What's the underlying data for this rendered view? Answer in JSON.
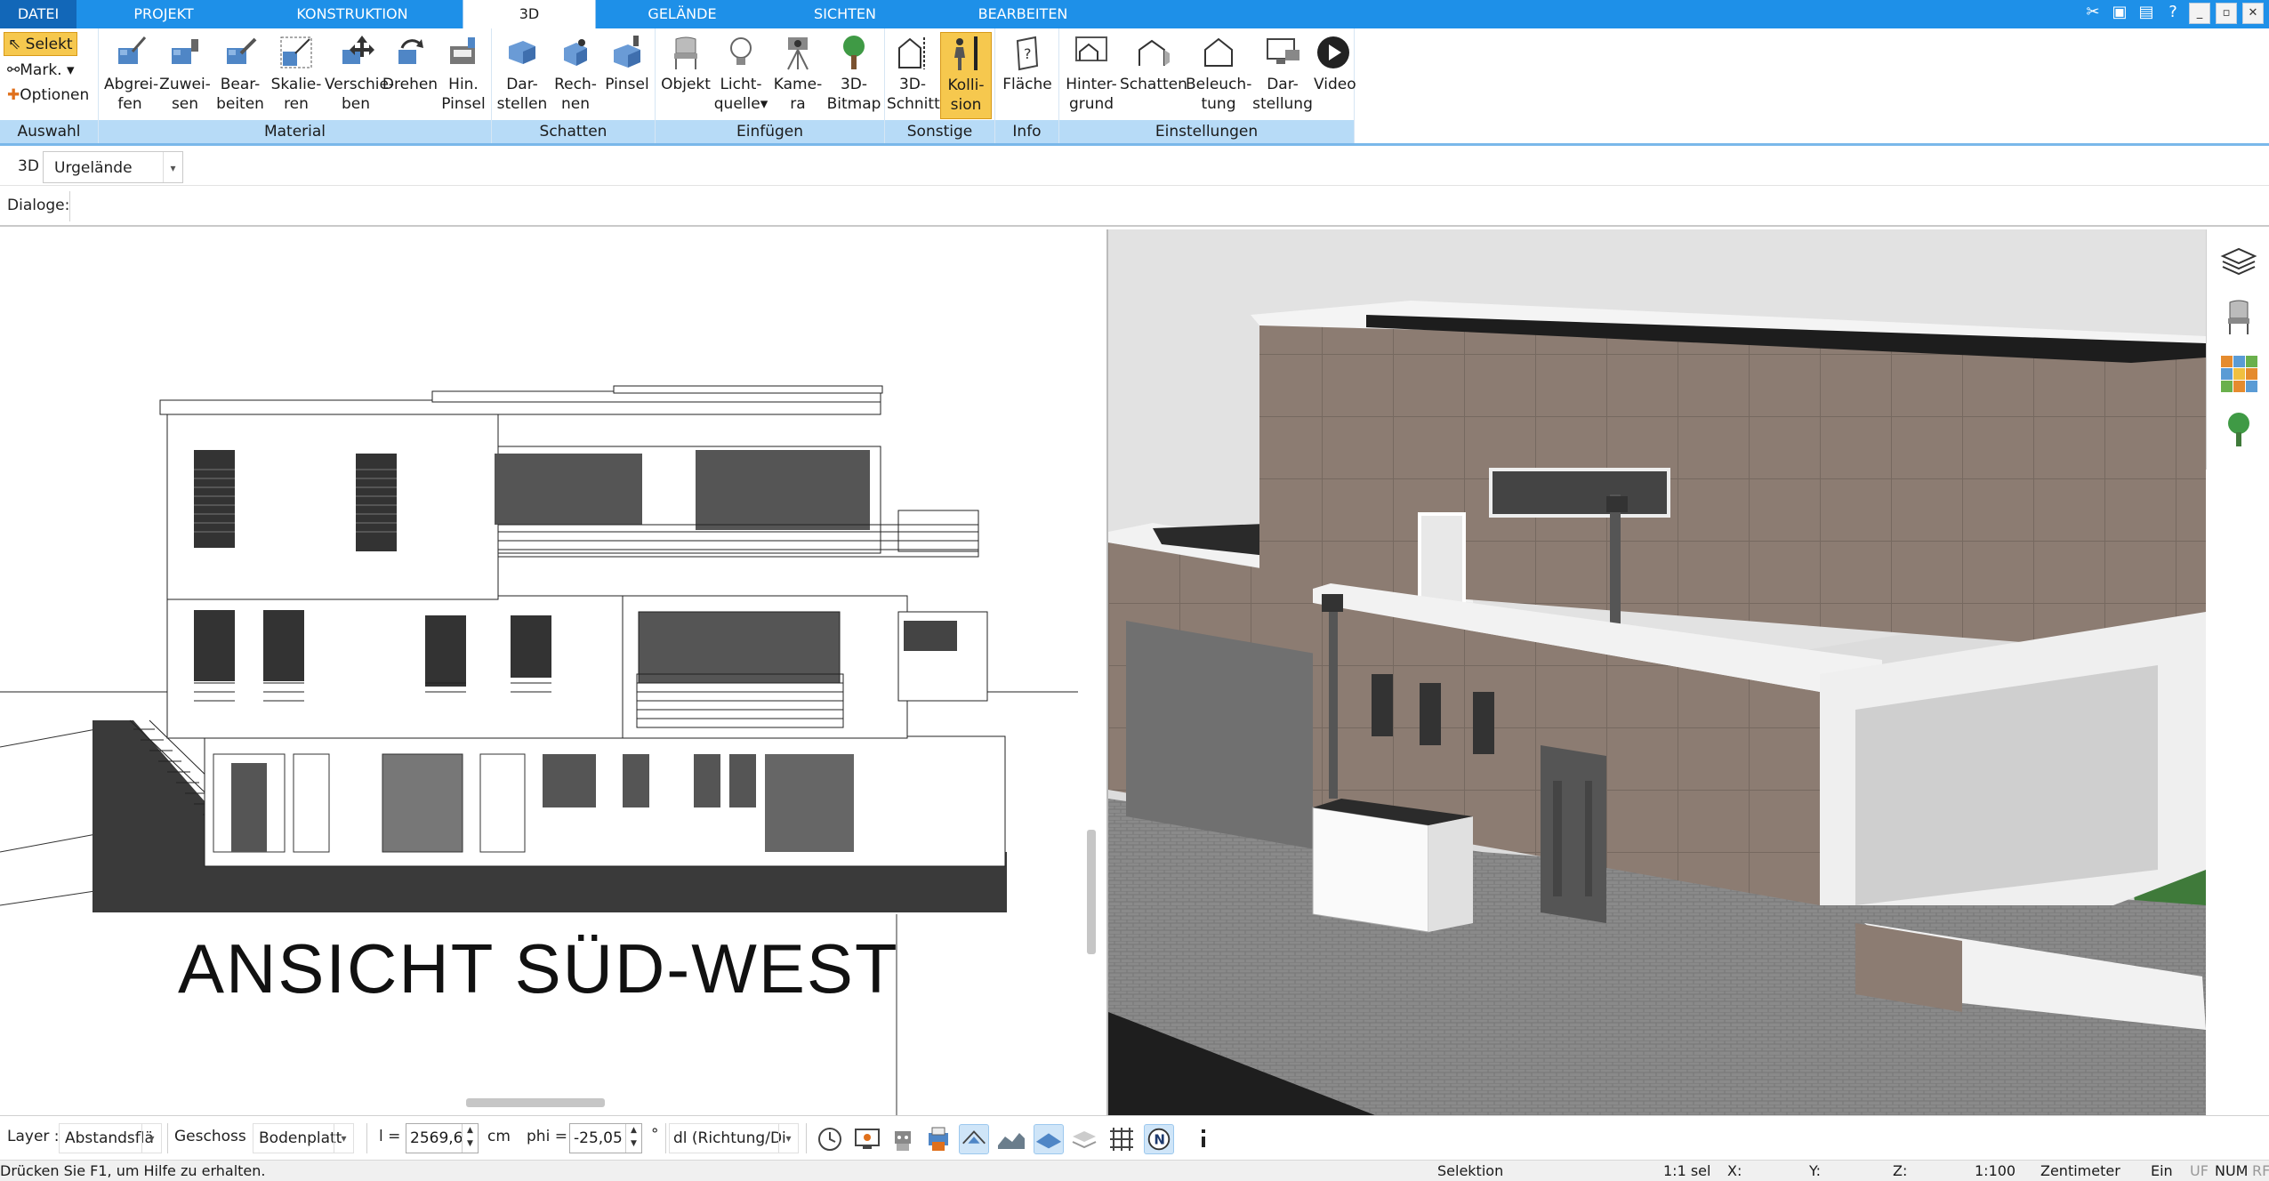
{
  "tabs": [
    "DATEI",
    "PROJEKT",
    "KONSTRUKTION",
    "3D",
    "GELÄNDE",
    "SICHTEN",
    "BEARBEITEN"
  ],
  "window_buttons": [
    "_",
    "▫",
    "✕"
  ],
  "ribbon": {
    "auswahl": {
      "label": "Auswahl",
      "items": [
        "Selekt",
        "Mark.",
        "Optionen"
      ]
    },
    "material": {
      "label": "Material",
      "buttons": [
        {
          "l1": "Abgrei-",
          "l2": "fen",
          "icon": "eyedropper-icon"
        },
        {
          "l1": "Zuwei-",
          "l2": "sen",
          "icon": "assign-icon"
        },
        {
          "l1": "Bear-",
          "l2": "beiten",
          "icon": "edit-material-icon"
        },
        {
          "l1": "Skalie-",
          "l2": "ren",
          "icon": "scale-icon"
        },
        {
          "l1": "Verschie-",
          "l2": "ben",
          "icon": "move-icon"
        },
        {
          "l1": "Drehen",
          "l2": "",
          "icon": "rotate-icon"
        },
        {
          "l1": "Hin.",
          "l2": "Pinsel",
          "icon": "brush-icon"
        }
      ]
    },
    "schatten": {
      "label": "Schatten",
      "buttons": [
        {
          "l1": "Dar-",
          "l2": "stellen",
          "icon": "shadow-display-icon"
        },
        {
          "l1": "Rech-",
          "l2": "nen",
          "icon": "shadow-calc-icon"
        },
        {
          "l1": "Pinsel",
          "l2": "",
          "icon": "shadow-brush-icon"
        }
      ]
    },
    "einfuegen": {
      "label": "Einfügen",
      "buttons": [
        {
          "l1": "Objekt",
          "l2": "",
          "icon": "chair-icon"
        },
        {
          "l1": "Licht-",
          "l2": "quelle",
          "icon": "bulb-icon"
        },
        {
          "l1": "Kame-",
          "l2": "ra",
          "icon": "camera-icon"
        },
        {
          "l1": "3D-",
          "l2": "Bitmap",
          "icon": "tree-icon"
        }
      ]
    },
    "sonstige": {
      "label": "Sonstige",
      "buttons": [
        {
          "l1": "3D-",
          "l2": "Schnitt",
          "icon": "section-icon"
        },
        {
          "l1": "Kolli-",
          "l2": "sion",
          "icon": "collision-icon"
        }
      ]
    },
    "info": {
      "label": "Info",
      "buttons": [
        {
          "l1": "Fläche",
          "l2": "",
          "icon": "area-icon"
        }
      ]
    },
    "einstellungen": {
      "label": "Einstellungen",
      "buttons": [
        {
          "l1": "Hinter-",
          "l2": "grund",
          "icon": "background-icon"
        },
        {
          "l1": "Schatten",
          "l2": "",
          "icon": "house-shadow-icon"
        },
        {
          "l1": "Beleuch-",
          "l2": "tung",
          "icon": "lighting-icon"
        },
        {
          "l1": "Dar-",
          "l2": "stellung",
          "icon": "display-icon"
        },
        {
          "l1": "Video",
          "l2": "",
          "icon": "play-icon"
        }
      ]
    }
  },
  "view_row": {
    "mode": "3D",
    "terrain": "Urgelände"
  },
  "dialog_row": {
    "label": "Dialoge:"
  },
  "drawing": {
    "title": "ANSICHT SÜD-WEST"
  },
  "bottom": {
    "layer_label": "Layer :",
    "layer_value": "Abstandsflä",
    "geschoss_label": "Geschoss :",
    "geschoss_value": "Bodenplatt",
    "l_label": "l =",
    "l_value": "2569,6",
    "l_unit": "cm",
    "phi_label": "phi =",
    "phi_value": "-25,05",
    "phi_unit": "°",
    "dl_value": "dl (Richtung/Di"
  },
  "status": {
    "help": "Drücken Sie F1, um Hilfe zu erhalten.",
    "mode": "Selektion",
    "sel": "1:1 sel",
    "x": "X:",
    "y": "Y:",
    "z": "Z:",
    "scale": "1:100",
    "unit": "Zentimeter",
    "ein": "Ein",
    "uf": "UF",
    "num": "NUM",
    "rf": "RF"
  }
}
